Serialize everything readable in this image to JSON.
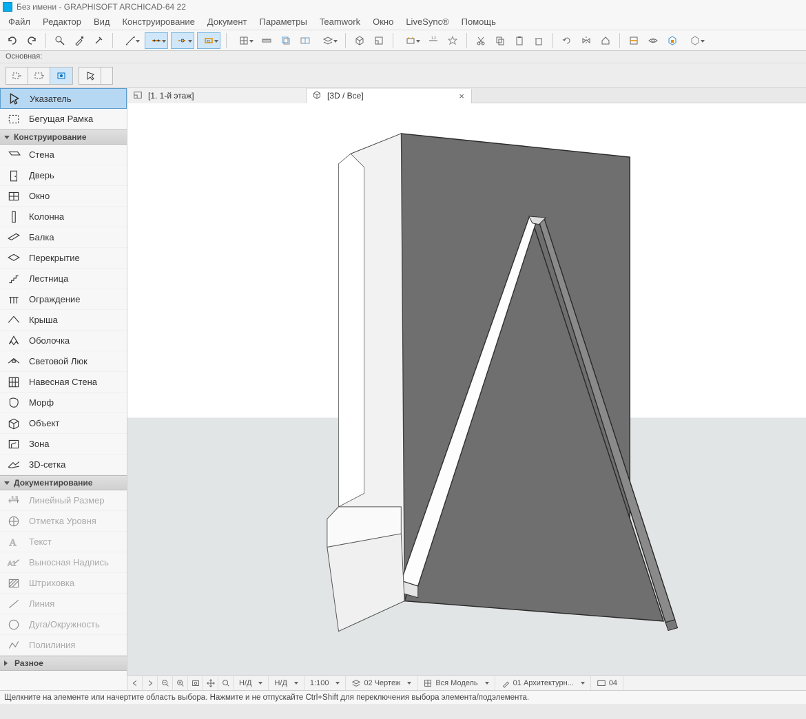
{
  "window": {
    "title": "Без имени - GRAPHISOFT ARCHICAD-64 22"
  },
  "menu": [
    "Файл",
    "Редактор",
    "Вид",
    "Конструирование",
    "Документ",
    "Параметры",
    "Teamwork",
    "Окно",
    "LiveSync®",
    "Помощь"
  ],
  "secondary_label": "Основная:",
  "toolbox": {
    "selection": [
      {
        "label": "Указатель",
        "icon": "arrow-icon",
        "selected": true
      },
      {
        "label": "Бегущая Рамка",
        "icon": "marquee-icon"
      }
    ],
    "sections": [
      {
        "title": "Конструирование",
        "items": [
          {
            "label": "Стена",
            "icon": "wall-icon"
          },
          {
            "label": "Дверь",
            "icon": "door-icon"
          },
          {
            "label": "Окно",
            "icon": "window-icon"
          },
          {
            "label": "Колонна",
            "icon": "column-icon"
          },
          {
            "label": "Балка",
            "icon": "beam-icon"
          },
          {
            "label": "Перекрытие",
            "icon": "slab-icon"
          },
          {
            "label": "Лестница",
            "icon": "stair-icon"
          },
          {
            "label": "Ограждение",
            "icon": "railing-icon"
          },
          {
            "label": "Крыша",
            "icon": "roof-icon"
          },
          {
            "label": "Оболочка",
            "icon": "shell-icon"
          },
          {
            "label": "Световой Люк",
            "icon": "skylight-icon"
          },
          {
            "label": "Навесная Стена",
            "icon": "curtainwall-icon"
          },
          {
            "label": "Морф",
            "icon": "morph-icon"
          },
          {
            "label": "Объект",
            "icon": "object-icon"
          },
          {
            "label": "Зона",
            "icon": "zone-icon"
          },
          {
            "label": "3D-сетка",
            "icon": "mesh-icon"
          }
        ]
      },
      {
        "title": "Документирование",
        "items": [
          {
            "label": "Линейный Размер",
            "icon": "dim-icon",
            "disabled": true
          },
          {
            "label": "Отметка Уровня",
            "icon": "level-icon",
            "disabled": true
          },
          {
            "label": "Текст",
            "icon": "text-icon",
            "disabled": true
          },
          {
            "label": "Выносная Надпись",
            "icon": "labelnote-icon",
            "disabled": true
          },
          {
            "label": "Штриховка",
            "icon": "hatch-icon",
            "disabled": true
          },
          {
            "label": "Линия",
            "icon": "line-icon",
            "disabled": true
          },
          {
            "label": "Дуга/Окружность",
            "icon": "arc-icon",
            "disabled": true
          },
          {
            "label": "Полилиния",
            "icon": "polyline-icon",
            "disabled": true
          }
        ]
      },
      {
        "title": "Разное",
        "collapsed": true,
        "items": []
      }
    ]
  },
  "tabs": [
    {
      "label": "[1. 1-й этаж]",
      "icon": "floor-icon"
    },
    {
      "label": "[3D / Все]",
      "icon": "cube-icon",
      "active": true,
      "closable": true
    }
  ],
  "view_toolbar": {
    "left_icons": [
      "nav-back-icon",
      "nav-fwd-icon",
      "zoom-out-icon",
      "zoom-in-icon",
      "zoom-fit-icon",
      "pan-icon",
      "zoom-dd-icon"
    ],
    "fields": [
      {
        "label": "Н/Д",
        "dd": true
      },
      {
        "label": "Н/Д",
        "dd": true
      },
      {
        "label": "1:100",
        "dd": true
      },
      {
        "icon": "layer-icon",
        "label": "02 Чертеж",
        "dd": true
      },
      {
        "icon": "model-icon",
        "label": "Вся Модель",
        "dd": true
      },
      {
        "icon": "pen-icon",
        "label": "01 Архитектурн...",
        "dd": true
      },
      {
        "icon": "view-icon",
        "label": "04"
      }
    ]
  },
  "statusbar": "Щелкните на элементе или начертите область выбора. Нажмите и не отпускайте Ctrl+Shift для переключения выбора элемента/подэлемента."
}
